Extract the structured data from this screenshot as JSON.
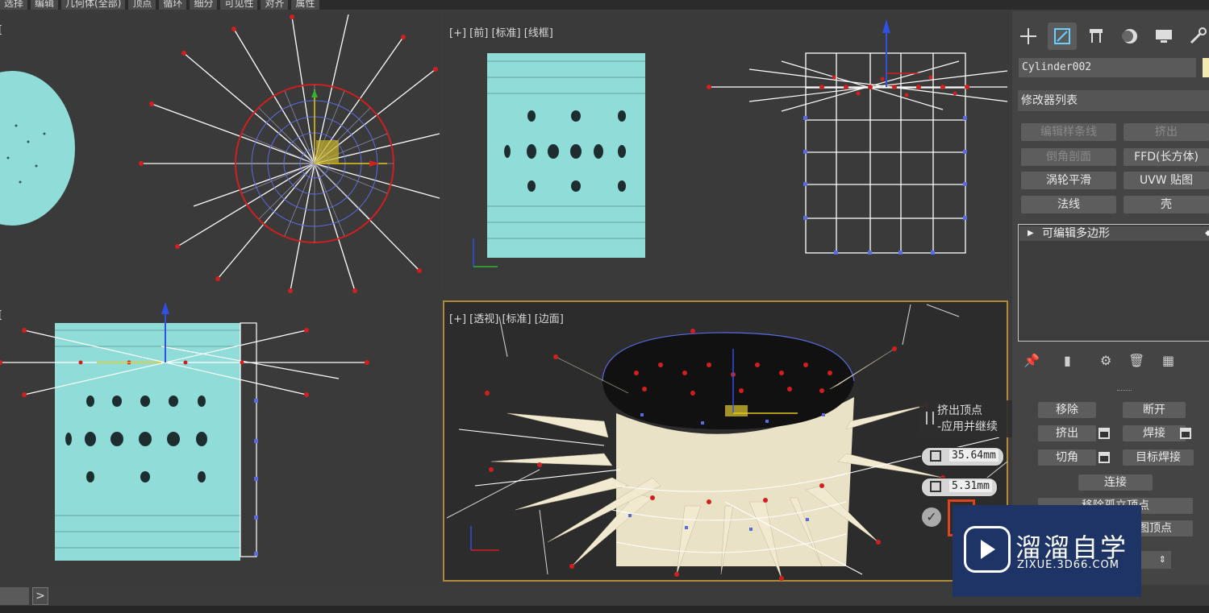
{
  "menubar": [
    "选择",
    "编辑",
    "几何体(全部)",
    "顶点",
    "循环",
    "细分",
    "可见性",
    "对齐",
    "属性"
  ],
  "viewports": {
    "top_label": "[",
    "front_label": "[+] [前] [标准] [线框]",
    "left_label": "[",
    "persp_label": "[+] [透视] [标准] [边面]"
  },
  "panel": {
    "tab_icons": [
      "create-icon",
      "modify-icon",
      "hierarchy-icon",
      "motion-icon",
      "display-icon",
      "utilities-icon"
    ],
    "object_name": "Cylinder002",
    "modifier_list": "修改器列表",
    "modifier_buttons": [
      {
        "label": "编辑样条线",
        "enabled": false
      },
      {
        "label": "挤出",
        "enabled": false
      },
      {
        "label": "倒角剖面",
        "enabled": false
      },
      {
        "label": "FFD(长方体)",
        "enabled": true
      },
      {
        "label": "涡轮平滑",
        "enabled": true
      },
      {
        "label": "UVW 贴图",
        "enabled": true
      },
      {
        "label": "法线",
        "enabled": true
      },
      {
        "label": "壳",
        "enabled": true
      }
    ],
    "stack_item": "可编辑多边形",
    "edit_vertices": {
      "remove": "移除",
      "break": "断开",
      "extrude": "挤出",
      "weld": "焊接",
      "chamfer": "切角",
      "target_weld": "目标焊接",
      "connect": "连接",
      "remove_isolated": "移除孤立顶点",
      "remove_unused_map": "移除未使用的贴图顶点"
    }
  },
  "caddy": {
    "title": "挤出顶点",
    "subtitle": "-应用并继续",
    "height_value": "35.64mm",
    "width_value": "5.31mm"
  },
  "statusbar": {
    "arrow": ">"
  },
  "watermark": {
    "brand": "溜溜自学",
    "url": "ZIXUE.3D66.COM"
  },
  "colors": {
    "viewport_bg": "#3a3a3a",
    "active_border": "#b08a36",
    "mesh_cyan": "#8fdcd8",
    "vertex_red": "#d11f1f",
    "vertex_blue": "#5a6be0",
    "wire_white": "#ffffff",
    "watermark_bg": "#1e3366"
  }
}
